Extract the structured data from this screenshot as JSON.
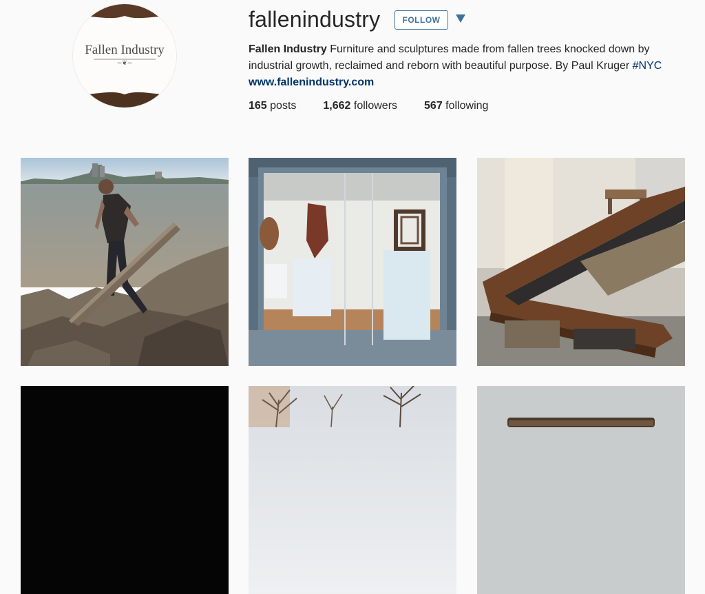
{
  "profile": {
    "username": "fallenindustry",
    "follow_label": "FOLLOW",
    "avatar_text": "Fallen Industry",
    "bio": {
      "name": "Fallen Industry",
      "text": " Furniture and sculptures made from fallen trees knocked down by industrial growth, reclaimed and reborn with beautiful purpose. By Paul Kruger ",
      "hashtag": "#NYC"
    },
    "website": "www.fallenindustry.com",
    "stats": {
      "posts_count": "165",
      "posts_label": " posts",
      "followers_count": "1,662",
      "followers_label": " followers",
      "following_count": "567",
      "following_label": " following"
    }
  },
  "colors": {
    "accent": "#3f729b",
    "link": "#003569",
    "background": "#fafafa"
  },
  "posts": [
    {
      "subject": "man-with-plank-on-river-rocks"
    },
    {
      "subject": "gallery-display-case-sculptures"
    },
    {
      "subject": "live-edge-wood-table-workshop"
    },
    {
      "subject": "dark-image"
    },
    {
      "subject": "bare-trees"
    },
    {
      "subject": "wood-bench-gray-backdrop"
    }
  ]
}
